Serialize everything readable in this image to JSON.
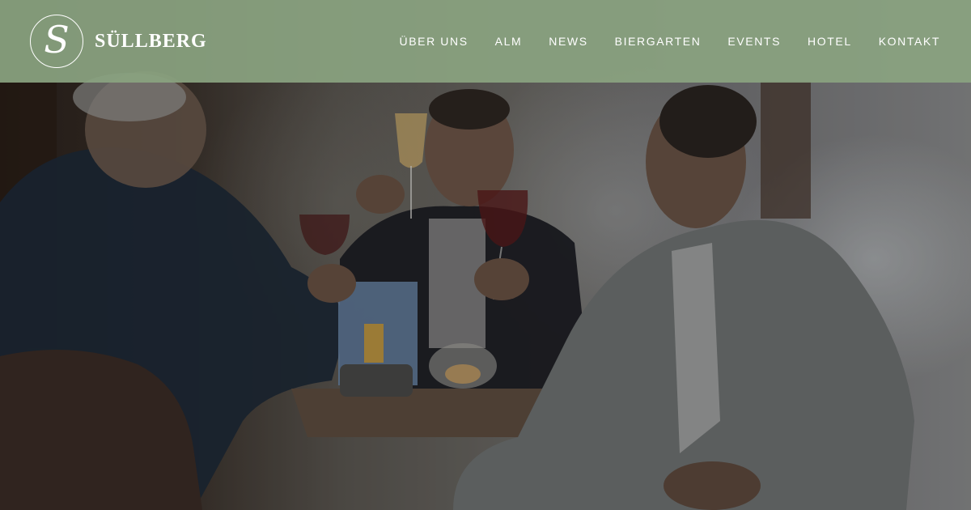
{
  "brand": {
    "logo_letter": "S",
    "name": "SÜLLBERG"
  },
  "nav": {
    "items": [
      {
        "label": "ÜBER UNS"
      },
      {
        "label": "ALM"
      },
      {
        "label": "NEWS"
      },
      {
        "label": "BIERGARTEN"
      },
      {
        "label": "EVENTS"
      },
      {
        "label": "HOTEL"
      },
      {
        "label": "KONTAKT"
      }
    ]
  },
  "colors": {
    "header_background": "#8aa380",
    "header_text": "#ffffff"
  },
  "hero": {
    "image_icon": "hero-photo"
  }
}
